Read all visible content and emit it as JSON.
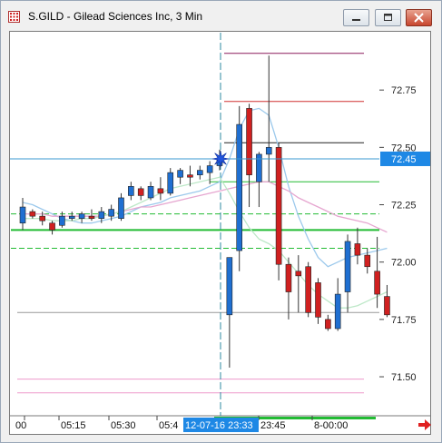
{
  "window": {
    "title": "S.GILD - Gilead Sciences Inc, 3 Min",
    "controls": [
      "minimize",
      "restore",
      "close"
    ]
  },
  "colors": {
    "up_candle": "#1f6fd1",
    "down_candle": "#d02020",
    "crosshair": "#2c8aa0",
    "current_price_badge": "#1e88e5",
    "highlight_time_badge": "#1e88e5",
    "pivot_maroon": "#8b1a5b",
    "pivot_red": "#d03030",
    "pivot_black": "#222222",
    "level_green": "#22bb33",
    "level_pink": "#ee99cc",
    "vwap_blue": "#9cc9ec",
    "ma_pink": "#e6a6d0",
    "ma_green": "#bde8c8"
  },
  "chart_data": {
    "type": "candlestick",
    "symbol": "S.GILD",
    "timeframe": "3 Min",
    "y_range": [
      71.33,
      73.0
    ],
    "y_ticks": [
      72.75,
      72.5,
      72.25,
      72.0,
      71.75,
      71.5
    ],
    "y_tick_labels": [
      "72.75",
      "72.50",
      "72.25",
      "72.00",
      "71.75",
      "71.50"
    ],
    "x_tick_labels": [
      "00",
      "05:15",
      "05:30",
      "05:4",
      "23:45",
      "8-00:00"
    ],
    "current_price": 72.45,
    "current_price_label": "72.45",
    "crosshair_time_label": "12-07-16 23:33",
    "candles": [
      {
        "o": 72.17,
        "h": 72.28,
        "l": 72.14,
        "c": 72.24
      },
      {
        "o": 72.22,
        "h": 72.23,
        "l": 72.19,
        "c": 72.2
      },
      {
        "o": 72.2,
        "h": 72.22,
        "l": 72.16,
        "c": 72.18
      },
      {
        "o": 72.17,
        "h": 72.18,
        "l": 72.12,
        "c": 72.14
      },
      {
        "o": 72.16,
        "h": 72.22,
        "l": 72.15,
        "c": 72.2
      },
      {
        "o": 72.19,
        "h": 72.22,
        "l": 72.18,
        "c": 72.2
      },
      {
        "o": 72.19,
        "h": 72.22,
        "l": 72.17,
        "c": 72.21
      },
      {
        "o": 72.2,
        "h": 72.23,
        "l": 72.18,
        "c": 72.19
      },
      {
        "o": 72.19,
        "h": 72.24,
        "l": 72.17,
        "c": 72.22
      },
      {
        "o": 72.2,
        "h": 72.25,
        "l": 72.18,
        "c": 72.23
      },
      {
        "o": 72.19,
        "h": 72.3,
        "l": 72.18,
        "c": 72.28
      },
      {
        "o": 72.29,
        "h": 72.35,
        "l": 72.27,
        "c": 72.33
      },
      {
        "o": 72.32,
        "h": 72.33,
        "l": 72.27,
        "c": 72.29
      },
      {
        "o": 72.28,
        "h": 72.35,
        "l": 72.27,
        "c": 72.33
      },
      {
        "o": 72.32,
        "h": 72.37,
        "l": 72.27,
        "c": 72.3
      },
      {
        "o": 72.3,
        "h": 72.41,
        "l": 72.29,
        "c": 72.39
      },
      {
        "o": 72.37,
        "h": 72.41,
        "l": 72.34,
        "c": 72.4
      },
      {
        "o": 72.38,
        "h": 72.42,
        "l": 72.33,
        "c": 72.37
      },
      {
        "o": 72.38,
        "h": 72.42,
        "l": 72.36,
        "c": 72.4
      },
      {
        "o": 72.39,
        "h": 72.44,
        "l": 72.34,
        "c": 72.42
      },
      {
        "o": 72.42,
        "h": 72.49,
        "l": 72.4,
        "c": 72.45
      },
      {
        "o": 71.77,
        "h": 72.02,
        "l": 71.54,
        "c": 72.02
      },
      {
        "o": 72.05,
        "h": 72.68,
        "l": 71.96,
        "c": 72.6
      },
      {
        "o": 72.67,
        "h": 72.69,
        "l": 72.24,
        "c": 72.38
      },
      {
        "o": 72.35,
        "h": 72.48,
        "l": 72.24,
        "c": 72.47
      },
      {
        "o": 72.47,
        "h": 72.9,
        "l": 72.35,
        "c": 72.5
      },
      {
        "o": 72.5,
        "h": 72.52,
        "l": 71.92,
        "c": 71.99
      },
      {
        "o": 71.99,
        "h": 72.02,
        "l": 71.75,
        "c": 71.87
      },
      {
        "o": 71.96,
        "h": 72.03,
        "l": 71.78,
        "c": 71.94
      },
      {
        "o": 71.98,
        "h": 72.0,
        "l": 71.76,
        "c": 71.78
      },
      {
        "o": 71.91,
        "h": 71.93,
        "l": 71.73,
        "c": 71.76
      },
      {
        "o": 71.75,
        "h": 71.77,
        "l": 71.7,
        "c": 71.71
      },
      {
        "o": 71.71,
        "h": 71.93,
        "l": 71.7,
        "c": 71.86
      },
      {
        "o": 71.87,
        "h": 72.12,
        "l": 71.78,
        "c": 72.09
      },
      {
        "o": 72.08,
        "h": 72.15,
        "l": 71.99,
        "c": 72.03
      },
      {
        "o": 72.03,
        "h": 72.06,
        "l": 71.95,
        "c": 71.98
      },
      {
        "o": 71.96,
        "h": 72.11,
        "l": 71.8,
        "c": 71.86
      },
      {
        "o": 71.85,
        "h": 71.9,
        "l": 71.76,
        "c": 71.77
      }
    ],
    "reference_levels": [
      {
        "price": 72.91,
        "color": "#8b1a5b",
        "style": "solid"
      },
      {
        "price": 72.7,
        "color": "#d03030",
        "style": "solid"
      },
      {
        "price": 72.52,
        "color": "#222222",
        "style": "solid"
      },
      {
        "price": 72.35,
        "color": "#22bb33",
        "style": "solid"
      },
      {
        "price": 72.21,
        "color": "#22bb33",
        "style": "dashed"
      },
      {
        "price": 72.14,
        "color": "#22bb33",
        "style": "solid-thick"
      },
      {
        "price": 72.06,
        "color": "#22bb33",
        "style": "dashed"
      },
      {
        "price": 71.78,
        "color": "#999999",
        "style": "solid"
      },
      {
        "price": 71.49,
        "color": "#ee99cc",
        "style": "solid"
      },
      {
        "price": 71.43,
        "color": "#ee99cc",
        "style": "solid"
      }
    ],
    "indicator_lines": [
      {
        "color": "#9cc9ec",
        "values": [
          72.26,
          72.25,
          72.23,
          72.21,
          72.19,
          72.18,
          72.17,
          72.17,
          72.18,
          72.19,
          72.2,
          72.22,
          72.24,
          72.25,
          72.26,
          72.28,
          72.29,
          72.3,
          72.31,
          72.33,
          72.35,
          72.45,
          72.58,
          72.66,
          72.67,
          72.64,
          72.5,
          72.33,
          72.2,
          72.1,
          72.02,
          71.98,
          72.0,
          72.02,
          72.03,
          72.04,
          72.05,
          72.06
        ]
      },
      {
        "color": "#e6a6d0",
        "values": [
          72.21,
          72.21,
          72.21,
          72.2,
          72.2,
          72.2,
          72.2,
          72.2,
          72.2,
          72.21,
          72.22,
          72.23,
          72.24,
          72.24,
          72.25,
          72.26,
          72.27,
          72.28,
          72.29,
          72.3,
          72.31,
          72.32,
          72.33,
          72.34,
          72.35,
          72.35,
          72.33,
          72.31,
          72.28,
          72.26,
          72.24,
          72.22,
          72.2,
          72.19,
          72.18,
          72.17,
          72.15,
          72.13
        ]
      },
      {
        "color": "#bde8c8",
        "values": [
          72.19,
          72.19,
          72.19,
          72.18,
          72.18,
          72.18,
          72.19,
          72.19,
          72.2,
          72.21,
          72.22,
          72.24,
          72.26,
          72.28,
          72.3,
          72.32,
          72.33,
          72.34,
          72.35,
          72.36,
          72.37,
          72.3,
          72.22,
          72.15,
          72.1,
          72.08,
          72.05,
          72.0,
          71.95,
          71.9,
          71.86,
          71.83,
          71.8,
          71.8,
          71.81,
          71.83,
          71.85,
          71.87
        ]
      }
    ]
  }
}
